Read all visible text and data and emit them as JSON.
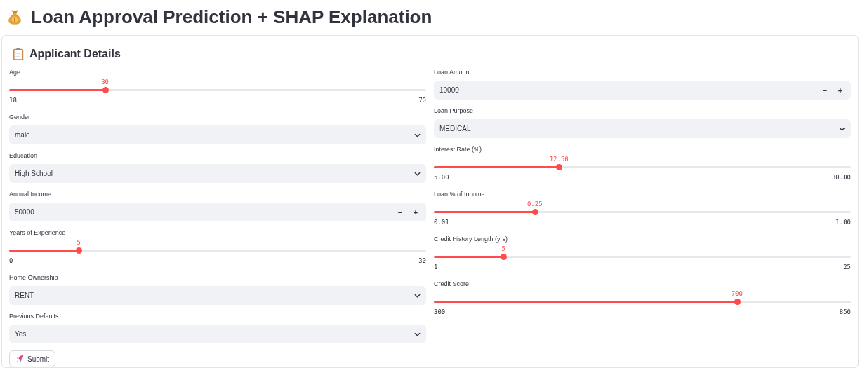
{
  "title": "Loan Approval Prediction + SHAP Explanation",
  "form": {
    "heading": "Applicant Details",
    "columns": [
      {
        "fields": [
          {
            "kind": "slider",
            "label": "Age",
            "value": "30",
            "min": "18",
            "max": "70",
            "level": 0.23
          },
          {
            "kind": "select",
            "label": "Gender",
            "value": "male"
          },
          {
            "kind": "select",
            "label": "Education",
            "value": "High School"
          },
          {
            "kind": "number",
            "label": "Annual Income",
            "value": "50000",
            "minus": "−",
            "plus": "+"
          },
          {
            "kind": "slider",
            "label": "Years of Experience",
            "value": "5",
            "min": "0",
            "max": "30",
            "level": 0.167
          },
          {
            "kind": "select",
            "label": "Home Ownership",
            "value": "RENT"
          },
          {
            "kind": "select",
            "label": "Previous Defaults",
            "value": "Yes"
          }
        ]
      },
      {
        "fields": [
          {
            "kind": "number",
            "label": "Loan Amount",
            "value": "10000",
            "minus": "−",
            "plus": "+"
          },
          {
            "kind": "select",
            "label": "Loan Purpose",
            "value": "MEDICAL"
          },
          {
            "kind": "slider",
            "label": "Interest Rate (%)",
            "value": "12.50",
            "min": "5.00",
            "max": "30.00",
            "level": 0.3
          },
          {
            "kind": "slider",
            "label": "Loan % of Income",
            "value": "0.25",
            "min": "0.01",
            "max": "1.00",
            "level": 0.242
          },
          {
            "kind": "slider",
            "label": "Credit History Length (yrs)",
            "value": "5",
            "min": "1",
            "max": "25",
            "level": 0.167
          },
          {
            "kind": "slider",
            "label": "Credit Score",
            "value": "700",
            "min": "300",
            "max": "850",
            "level": 0.727
          }
        ]
      }
    ],
    "submit": "Submit"
  }
}
